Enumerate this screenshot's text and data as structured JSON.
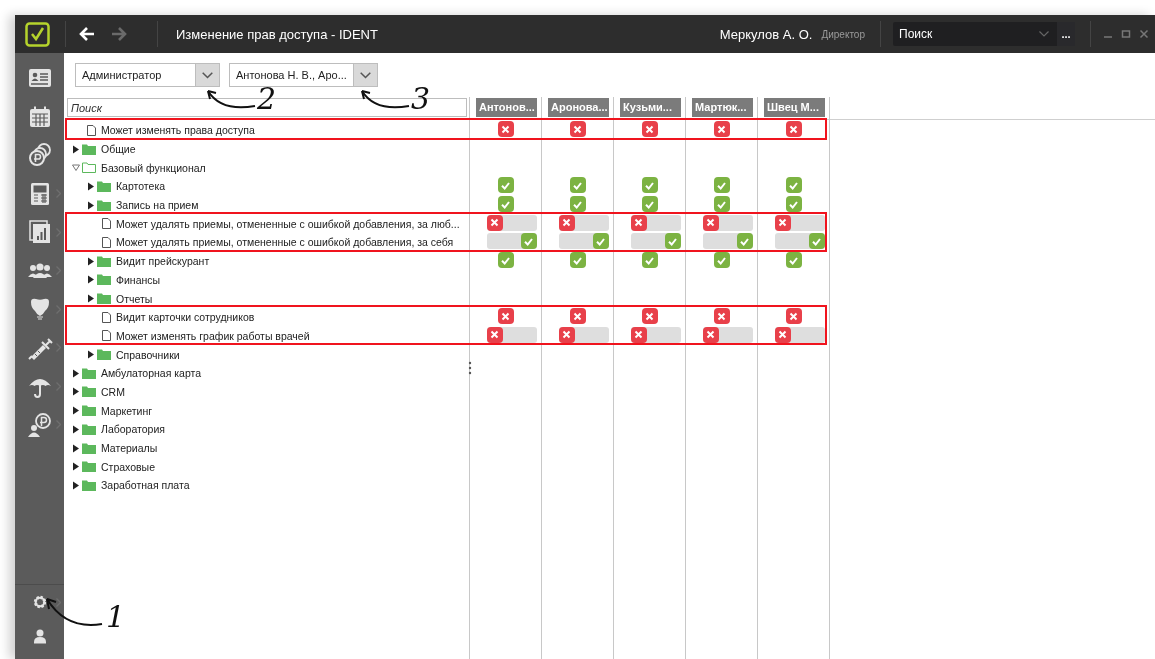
{
  "window": {
    "title": "Изменение прав доступа - IDENT"
  },
  "navigation": [
    {
      "kind": "back",
      "disabled": false
    },
    {
      "kind": "forward",
      "disabled": true
    }
  ],
  "user": {
    "name": "Меркулов А. О.",
    "role": "Директор"
  },
  "global_search": {
    "placeholder": "Поиск",
    "more_button": "..."
  },
  "sidebar": {
    "items": [
      {
        "submenu": false
      },
      {
        "submenu": false
      },
      {
        "submenu": false
      },
      {
        "submenu": true
      },
      {
        "submenu": true
      },
      {
        "submenu": true
      },
      {
        "submenu": true
      },
      {
        "submenu": true
      },
      {
        "submenu": true
      },
      {
        "submenu": true
      }
    ],
    "bottom_items": [
      {
        "submenu": true
      },
      {
        "submenu": false
      }
    ]
  },
  "filters": [
    {
      "value": "Администратор"
    },
    {
      "value": "Антонова Н. В., Аро..."
    }
  ],
  "tree_search": {
    "placeholder": "Поиск"
  },
  "columns": [
    {
      "name": "Антонов..."
    },
    {
      "name": "Аронова..."
    },
    {
      "name": "Кузьми..."
    },
    {
      "name": "Мартюк..."
    },
    {
      "name": "Швец М..."
    }
  ],
  "tree": [
    {
      "kind": "permission",
      "label": "Может изменять права доступа",
      "highlighted": true,
      "cells": [
        {
          "kind": "badge",
          "allowed": false
        },
        {
          "kind": "badge",
          "allowed": false
        },
        {
          "kind": "badge",
          "allowed": false
        },
        {
          "kind": "badge",
          "allowed": false
        },
        {
          "kind": "badge",
          "allowed": false
        }
      ]
    },
    {
      "kind": "folder",
      "label": "Общие",
      "expanded": false,
      "highlighted": false
    },
    {
      "kind": "folder",
      "label": "Базовый функционал",
      "expanded": true,
      "highlighted": false,
      "children": [
        {
          "kind": "folder",
          "label": "Картотека",
          "expanded": false,
          "highlighted": false,
          "cells": [
            {
              "kind": "badge",
              "allowed": true
            },
            {
              "kind": "badge",
              "allowed": true
            },
            {
              "kind": "badge",
              "allowed": true
            },
            {
              "kind": "badge",
              "allowed": true
            },
            {
              "kind": "badge",
              "allowed": true
            }
          ]
        },
        {
          "kind": "folder",
          "label": "Запись на прием",
          "expanded": false,
          "highlighted": false,
          "cells": [
            {
              "kind": "badge",
              "allowed": true
            },
            {
              "kind": "badge",
              "allowed": true
            },
            {
              "kind": "badge",
              "allowed": true
            },
            {
              "kind": "badge",
              "allowed": true
            },
            {
              "kind": "badge",
              "allowed": true
            }
          ]
        },
        {
          "kind": "permission",
          "label": "Может удалять приемы, отмененные с ошибкой добавления, за люб...",
          "highlighted": true,
          "cells": [
            {
              "kind": "switch",
              "on": false
            },
            {
              "kind": "switch",
              "on": false
            },
            {
              "kind": "switch",
              "on": false
            },
            {
              "kind": "switch",
              "on": false
            },
            {
              "kind": "switch",
              "on": false
            }
          ]
        },
        {
          "kind": "permission",
          "label": "Может удалять приемы, отмененные с ошибкой добавления, за себя",
          "highlighted": true,
          "cells": [
            {
              "kind": "switch",
              "on": true
            },
            {
              "kind": "switch",
              "on": true
            },
            {
              "kind": "switch",
              "on": true
            },
            {
              "kind": "switch",
              "on": true
            },
            {
              "kind": "switch",
              "on": true
            }
          ]
        },
        {
          "kind": "folder",
          "label": "Видит прейскурант",
          "expanded": false,
          "highlighted": false,
          "cells": [
            {
              "kind": "badge",
              "allowed": true
            },
            {
              "kind": "badge",
              "allowed": true
            },
            {
              "kind": "badge",
              "allowed": true
            },
            {
              "kind": "badge",
              "allowed": true
            },
            {
              "kind": "badge",
              "allowed": true
            }
          ]
        },
        {
          "kind": "folder",
          "label": "Финансы",
          "expanded": false,
          "highlighted": false
        },
        {
          "kind": "folder",
          "label": "Отчеты",
          "expanded": false,
          "highlighted": false
        },
        {
          "kind": "permission",
          "label": "Видит карточки сотрудников",
          "highlighted": true,
          "cells": [
            {
              "kind": "badge",
              "allowed": false
            },
            {
              "kind": "badge",
              "allowed": false
            },
            {
              "kind": "badge",
              "allowed": false
            },
            {
              "kind": "badge",
              "allowed": false
            },
            {
              "kind": "badge",
              "allowed": false
            }
          ]
        },
        {
          "kind": "permission",
          "label": "Может изменять график работы врачей",
          "highlighted": true,
          "cells": [
            {
              "kind": "switch",
              "on": false
            },
            {
              "kind": "switch",
              "on": false
            },
            {
              "kind": "switch",
              "on": false
            },
            {
              "kind": "switch",
              "on": false
            },
            {
              "kind": "switch",
              "on": false
            }
          ]
        },
        {
          "kind": "folder",
          "label": "Справочники",
          "expanded": false,
          "highlighted": false
        }
      ]
    },
    {
      "kind": "folder",
      "label": "Амбулаторная карта",
      "expanded": false,
      "highlighted": false
    },
    {
      "kind": "folder",
      "label": "CRM",
      "expanded": false,
      "highlighted": false
    },
    {
      "kind": "folder",
      "label": "Маркетинг",
      "expanded": false,
      "highlighted": false
    },
    {
      "kind": "folder",
      "label": "Лаборатория",
      "expanded": false,
      "highlighted": false
    },
    {
      "kind": "folder",
      "label": "Материалы",
      "expanded": false,
      "highlighted": false
    },
    {
      "kind": "folder",
      "label": "Страховые",
      "expanded": false,
      "highlighted": false
    },
    {
      "kind": "folder",
      "label": "Заработная плата",
      "expanded": false,
      "highlighted": false
    }
  ],
  "callouts": [
    {
      "label": "1"
    },
    {
      "label": "2"
    },
    {
      "label": "3"
    }
  ]
}
